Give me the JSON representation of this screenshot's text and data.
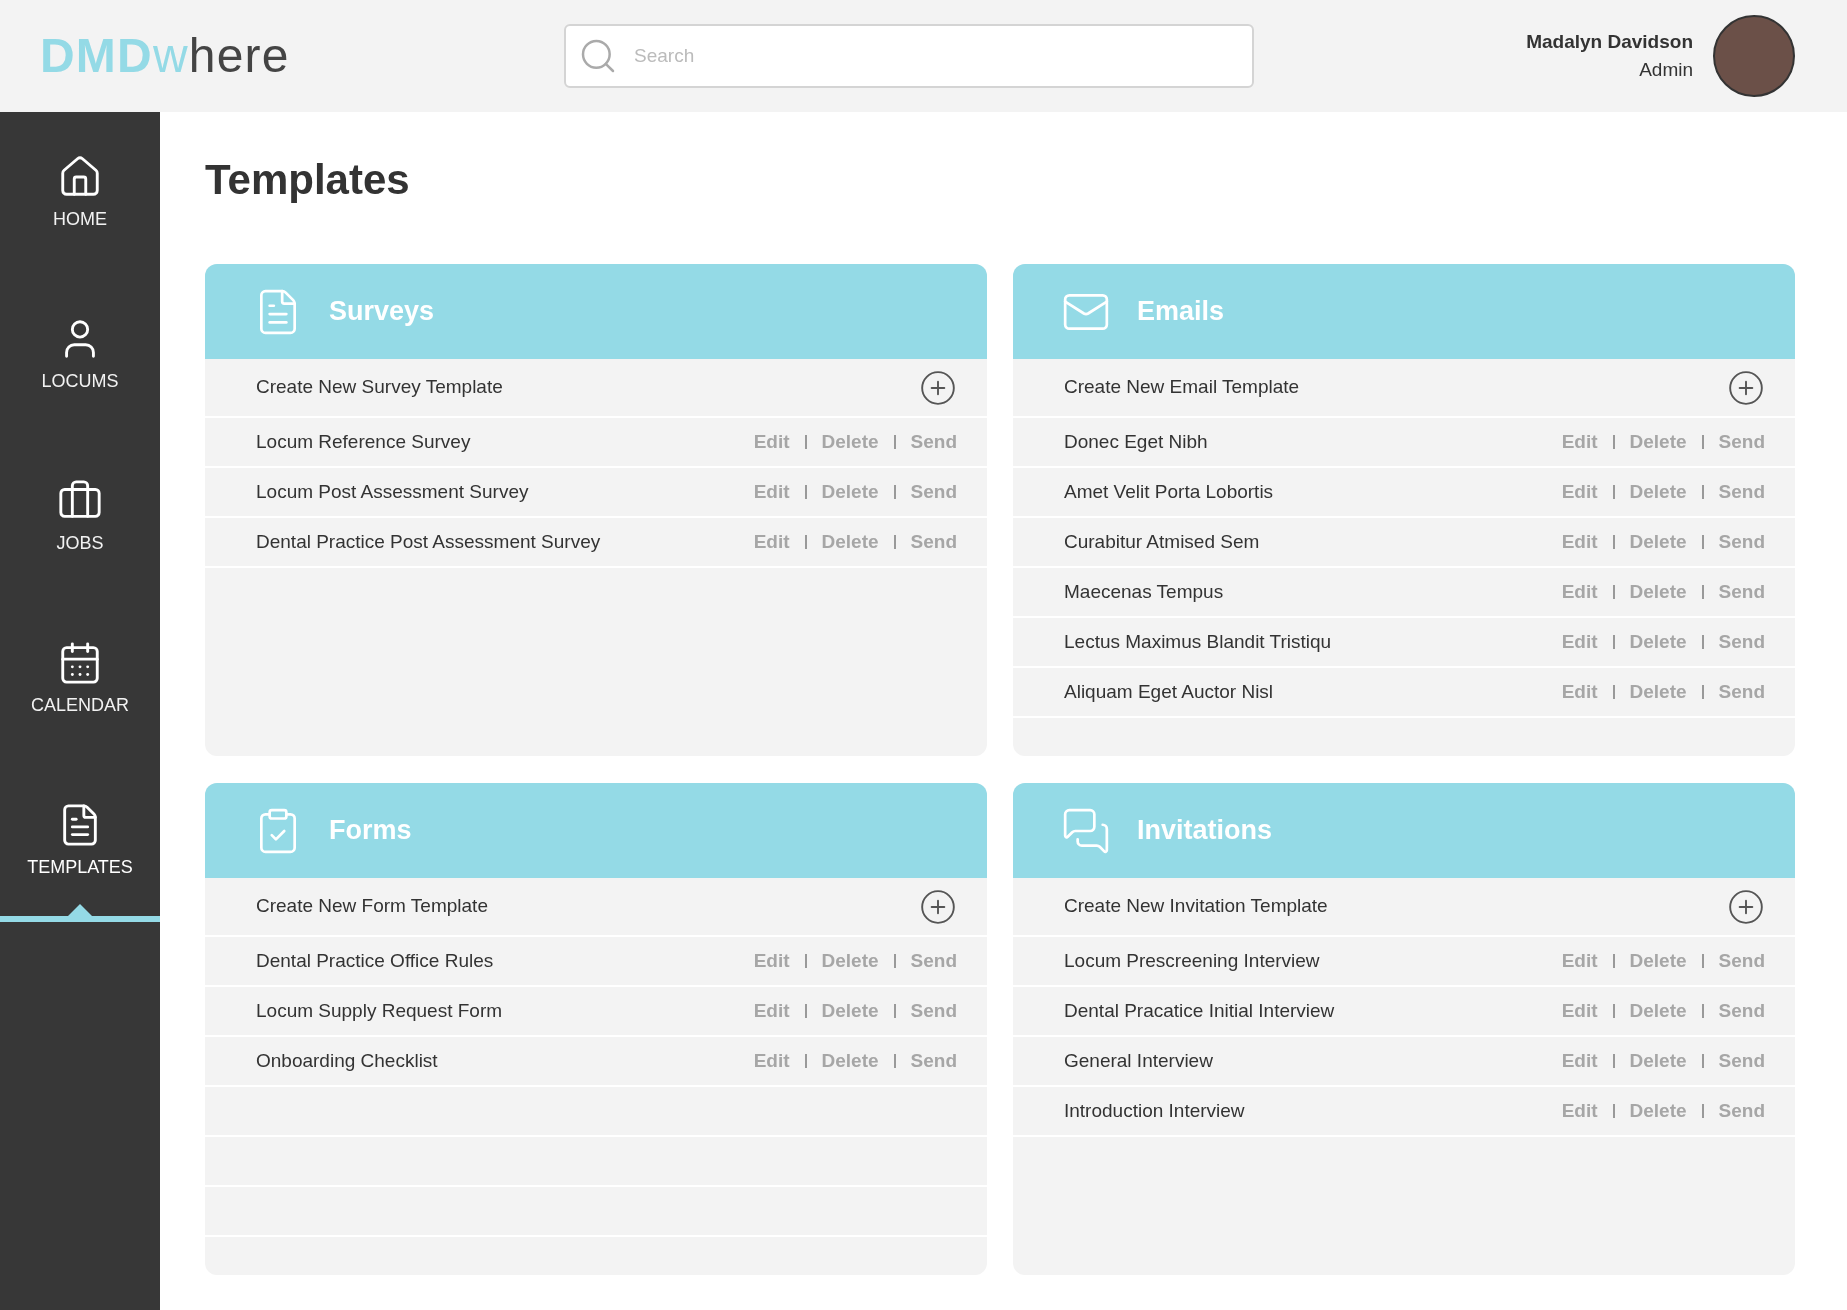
{
  "logo": {
    "strong": "DMD",
    "light": "where"
  },
  "search": {
    "placeholder": "Search"
  },
  "user": {
    "name": "Madalyn Davidson",
    "role": "Admin"
  },
  "sidebar": {
    "items": [
      {
        "label": "HOME",
        "kind": "home",
        "selected": false
      },
      {
        "label": "LOCUMS",
        "kind": "user",
        "selected": false
      },
      {
        "label": "JOBS",
        "kind": "briefcase",
        "selected": false
      },
      {
        "label": "CALENDAR",
        "kind": "calendar",
        "selected": false
      },
      {
        "label": "TEMPLATES",
        "kind": "document",
        "selected": true
      }
    ]
  },
  "page_title": "Templates",
  "cards": [
    {
      "title": "Surveys",
      "kind": "document",
      "create": "Create New Survey Template",
      "rows": [
        {
          "name": "Locum Reference Survey",
          "actions": [
            "Edit",
            "Delete",
            "Send"
          ]
        },
        {
          "name": "Locum Post Assessment Survey",
          "actions": [
            "Edit",
            "Delete",
            "Send"
          ]
        },
        {
          "name": "Dental Practice Post Assessment Survey",
          "actions": [
            "Edit",
            "Delete",
            "Send"
          ]
        }
      ]
    },
    {
      "title": "Emails",
      "kind": "envelope",
      "create": "Create New Email Template",
      "rows": [
        {
          "name": "Donec Eget Nibh",
          "actions": [
            "Edit",
            "Delete",
            "Send"
          ]
        },
        {
          "name": "Amet Velit Porta Lobortis",
          "actions": [
            "Edit",
            "Delete",
            "Send"
          ]
        },
        {
          "name": "Curabitur Atmised Sem",
          "actions": [
            "Edit",
            "Delete",
            "Send"
          ]
        },
        {
          "name": "Maecenas Tempus",
          "actions": [
            "Edit",
            "Delete",
            "Send"
          ]
        },
        {
          "name": "Lectus Maximus Blandit Tristiqu",
          "actions": [
            "Edit",
            "Delete",
            "Send"
          ]
        },
        {
          "name": "Aliquam Eget Auctor Nisl",
          "actions": [
            "Edit",
            "Delete",
            "Send"
          ]
        }
      ]
    },
    {
      "title": "Forms",
      "kind": "clipboard",
      "ruled": true,
      "create": "Create New Form Template",
      "rows": [
        {
          "name": "Dental Practice Office Rules",
          "actions": [
            "Edit",
            "Delete",
            "Send"
          ]
        },
        {
          "name": "Locum Supply Request Form",
          "actions": [
            "Edit",
            "Delete",
            "Send"
          ]
        },
        {
          "name": "Onboarding Checklist",
          "actions": [
            "Edit",
            "Delete",
            "Send"
          ]
        }
      ]
    },
    {
      "title": "Invitations",
      "kind": "chat",
      "create": "Create New Invitation Template",
      "rows": [
        {
          "name": "Locum Prescreening Interview",
          "actions": [
            "Edit",
            "Delete",
            "Send"
          ]
        },
        {
          "name": "Dental Pracatice Initial Interview",
          "actions": [
            "Edit",
            "Delete",
            "Send"
          ]
        },
        {
          "name": "General Interview",
          "actions": [
            "Edit",
            "Delete",
            "Send"
          ]
        },
        {
          "name": "Introduction Interview",
          "actions": [
            "Edit",
            "Delete",
            "Send"
          ]
        }
      ]
    }
  ]
}
